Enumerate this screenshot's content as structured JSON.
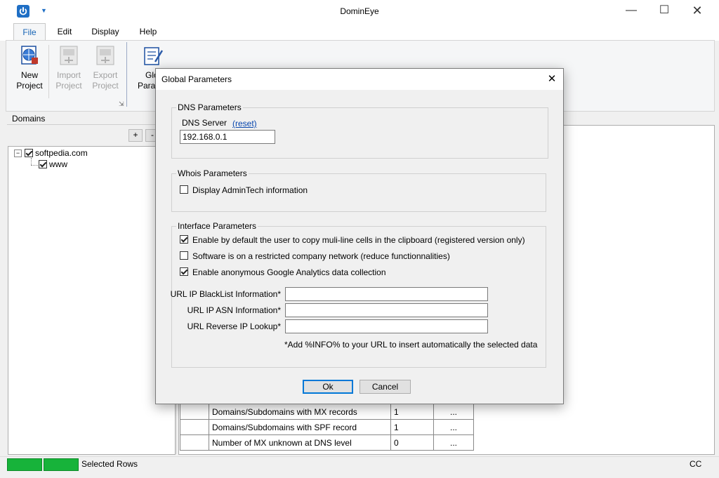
{
  "window": {
    "title": "DominEye"
  },
  "menu": {
    "tabs": [
      "File",
      "Edit",
      "Display",
      "Help"
    ]
  },
  "ribbon": {
    "buttons": [
      {
        "line1": "New",
        "line2": "Project"
      },
      {
        "line1": "Import",
        "line2": "Project"
      },
      {
        "line1": "Export",
        "line2": "Project"
      },
      {
        "line1": "Glo",
        "line2": "Para"
      }
    ]
  },
  "domains": {
    "label": "Domains",
    "add_label": "+",
    "remove_label": "-",
    "tree": [
      {
        "label": "softpedia.com",
        "checked": true
      },
      {
        "label": "www",
        "checked": true
      }
    ]
  },
  "table": {
    "rows": [
      {
        "name": "Domains/Subdomains with MX records",
        "value": "1",
        "action": "..."
      },
      {
        "name": "Domains/Subdomains with SPF record",
        "value": "1",
        "action": "..."
      },
      {
        "name": "Number of MX unknown at DNS level",
        "value": "0",
        "action": "..."
      }
    ]
  },
  "status": {
    "text": "Selected Rows",
    "right": "CC"
  },
  "dialog": {
    "title": "Global Parameters",
    "dns": {
      "group_label": "DNS Parameters",
      "server_label": "DNS Server",
      "reset_link": "(reset)",
      "server_value": "192.168.0.1"
    },
    "whois": {
      "group_label": "Whois Parameters",
      "admintech_label": "Display AdminTech information",
      "admintech_checked": false
    },
    "interface": {
      "group_label": "Interface Parameters",
      "options": [
        {
          "label": "Enable by default the user to copy muli-line cells in the clipboard (registered version only)",
          "checked": true
        },
        {
          "label": "Software is on a restricted company network (reduce functionnalities)",
          "checked": false
        },
        {
          "label": "Enable anonymous Google Analytics data collection",
          "checked": true
        }
      ],
      "url_blacklist_label": "URL IP BlackList Information*",
      "url_asn_label": "URL IP ASN Information*",
      "url_reverse_label": "URL Reverse IP Lookup*",
      "url_blacklist_value": "",
      "url_asn_value": "",
      "url_reverse_value": "",
      "note": "*Add %INFO% to your URL to insert automatically the selected data"
    },
    "ok_label": "Ok",
    "cancel_label": "Cancel"
  }
}
